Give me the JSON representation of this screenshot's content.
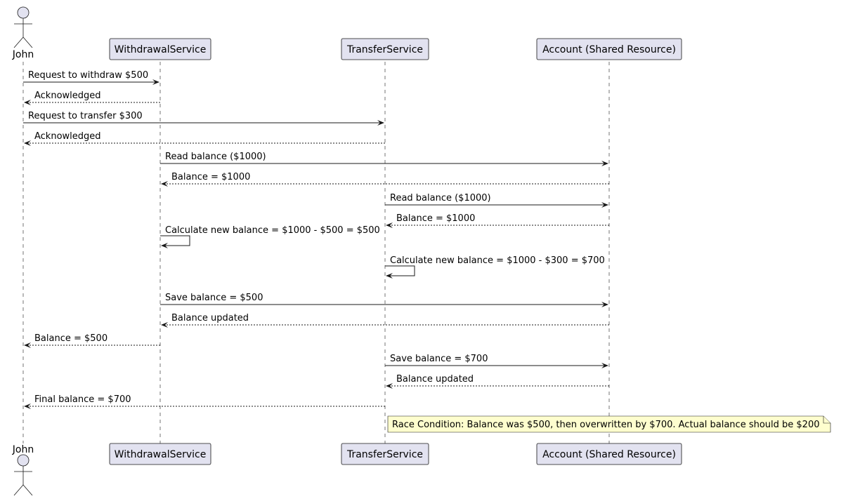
{
  "participants": [
    {
      "id": "john",
      "label": "John",
      "kind": "actor"
    },
    {
      "id": "withdrawal",
      "label": "WithdrawalService",
      "kind": "participant"
    },
    {
      "id": "transfer",
      "label": "TransferService",
      "kind": "participant"
    },
    {
      "id": "account",
      "label": "Account (Shared Resource)",
      "kind": "participant"
    }
  ],
  "messages": [
    {
      "from": "john",
      "to": "withdrawal",
      "text": "Request to withdraw $500",
      "style": "solid"
    },
    {
      "from": "withdrawal",
      "to": "john",
      "text": "Acknowledged",
      "style": "dashed"
    },
    {
      "from": "john",
      "to": "transfer",
      "text": "Request to transfer $300",
      "style": "solid"
    },
    {
      "from": "transfer",
      "to": "john",
      "text": "Acknowledged",
      "style": "dashed"
    },
    {
      "from": "withdrawal",
      "to": "account",
      "text": "Read balance ($1000)",
      "style": "solid"
    },
    {
      "from": "account",
      "to": "withdrawal",
      "text": "Balance = $1000",
      "style": "dashed"
    },
    {
      "from": "transfer",
      "to": "account",
      "text": "Read balance ($1000)",
      "style": "solid"
    },
    {
      "from": "account",
      "to": "transfer",
      "text": "Balance = $1000",
      "style": "dashed"
    },
    {
      "from": "withdrawal",
      "to": "withdrawal",
      "text": "Calculate new balance = $1000 - $500 = $500",
      "style": "solid"
    },
    {
      "from": "transfer",
      "to": "transfer",
      "text": "Calculate new balance = $1000 - $300 = $700",
      "style": "solid"
    },
    {
      "from": "withdrawal",
      "to": "account",
      "text": "Save balance = $500",
      "style": "solid"
    },
    {
      "from": "account",
      "to": "withdrawal",
      "text": "Balance updated",
      "style": "dashed"
    },
    {
      "from": "withdrawal",
      "to": "john",
      "text": "Balance = $500",
      "style": "dashed"
    },
    {
      "from": "transfer",
      "to": "account",
      "text": "Save balance = $700",
      "style": "solid"
    },
    {
      "from": "account",
      "to": "transfer",
      "text": "Balance updated",
      "style": "dashed"
    },
    {
      "from": "transfer",
      "to": "john",
      "text": "Final balance = $700",
      "style": "dashed"
    }
  ],
  "note": {
    "text": "Race Condition: Balance was $500, then overwritten by $700. Actual balance should be $200"
  },
  "colors": {
    "participant_fill": "#e2e2f0",
    "note_fill": "#fefece",
    "line": "#181818"
  }
}
